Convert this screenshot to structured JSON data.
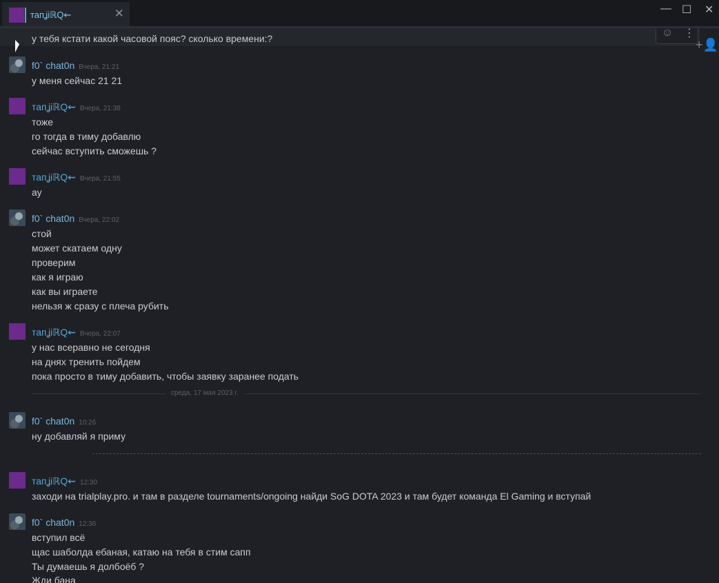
{
  "window": {
    "tab_title": "тапʝiℝQ⇜",
    "tab_close": "✕",
    "minimize": "—",
    "maximize": "☐",
    "close": "✕"
  },
  "chat": {
    "toolbar": {
      "emoji_icon": "☺",
      "menu_icon": "⋮",
      "add_friend_icon": "+👤"
    },
    "first_message": "у тебя кстати какой часовой пояс? сколько времени:?",
    "groups": [
      {
        "author": "f0` chat0n",
        "time": "Вчера, 21:21",
        "lines": [
          "у меня сейчас 21 21"
        ]
      },
      {
        "author": "тапʝiℝQ⇜",
        "time": "Вчера, 21:38",
        "lines": [
          "тоже",
          "го тогда в тиму добавлю",
          "сейчас вступить сможешь ?"
        ]
      },
      {
        "author": "тапʝiℝQ⇜",
        "time": "Вчера, 21:55",
        "lines": [
          "ау"
        ]
      },
      {
        "author": "f0` chat0n",
        "time": "Вчера, 22:02",
        "lines": [
          "стой",
          "может скатаем одну",
          "проверим",
          "как я играю",
          "как вы играете",
          "нельзя ж сразу с плеча рубить"
        ]
      },
      {
        "author": "тапʝiℝQ⇜",
        "time": "Вчера, 22:07",
        "lines": [
          "у нас всеравно не сегодня",
          "на днях тренить пойдем",
          "пока просто в тиму добавить, чтобы заявку заранее подать"
        ]
      },
      {
        "author": "f0` chat0n",
        "time": "10:26",
        "lines": [
          "ну добавляй я приму"
        ]
      },
      {
        "author": "тапʝiℝQ⇜",
        "time": "12:30",
        "lines": [
          "заходи на trialplay.pro. и там в разделе tournaments/ongoing найди SoG DOTA 2023 и там будет команда El Gaming и вступай"
        ]
      },
      {
        "author": "f0` chat0n",
        "time": "12:36",
        "lines": [
          "вступил всё",
          "щас шаболда ебаная, катаю на тебя в стим сапп",
          "Ты думаешь я долбоёб ?",
          "Жди бана"
        ]
      }
    ],
    "day_divider": "среда, 17 мая 2023 г."
  }
}
